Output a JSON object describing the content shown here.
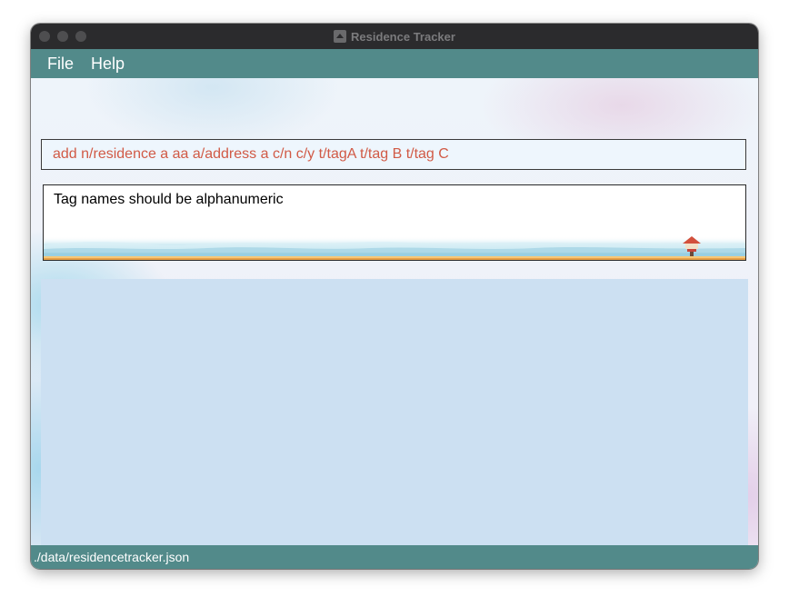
{
  "window": {
    "title": "Residence Tracker"
  },
  "menu": {
    "items": [
      {
        "label": "File"
      },
      {
        "label": "Help"
      }
    ]
  },
  "command_box": {
    "value": "add n/residence a aa a/address a c/n c/y t/tagA t/tag B t/tag C",
    "text_color": "#d15a46"
  },
  "result_display": {
    "message": "Tag names should be alphanumeric"
  },
  "status_bar": {
    "file_path": "./data/residencetracker.json"
  },
  "colors": {
    "accent": "#528a8a",
    "list_panel": "#cce0f2",
    "titlebar": "#2b2b2d"
  }
}
